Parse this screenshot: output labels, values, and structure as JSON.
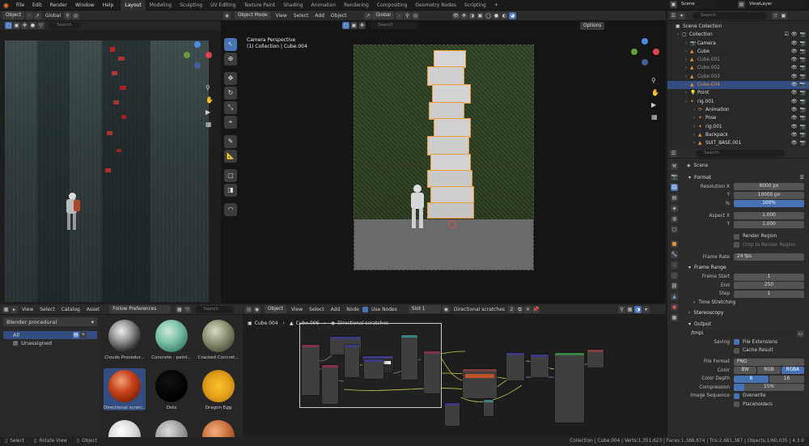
{
  "topbar": {
    "menus": [
      "File",
      "Edit",
      "Render",
      "Window",
      "Help"
    ],
    "workspaces": [
      "Layout",
      "Modeling",
      "Sculpting",
      "UV Editing",
      "Texture Paint",
      "Shading",
      "Animation",
      "Rendering",
      "Compositing",
      "Geometry Nodes",
      "Scripting"
    ],
    "active_workspace": "Layout",
    "add_tab": "+",
    "scene": "Scene",
    "view_layer": "ViewLayer"
  },
  "image_viewer": {
    "mode": "Object",
    "orientation": "Global",
    "search_placeholder": "Search"
  },
  "viewport": {
    "mode": "Object Mode",
    "menus": [
      "View",
      "Select",
      "Add",
      "Object"
    ],
    "orientation": "Global",
    "options": "Options",
    "title": "Camera Perspective",
    "subtitle": "(1) Collection | Cube.004",
    "search_placeholder": "Search"
  },
  "outliner": {
    "search_placeholder": "Search",
    "items": [
      {
        "label": "Scene Collection",
        "style": "nm"
      },
      {
        "label": "Collection",
        "style": "nm"
      },
      {
        "label": "Camera",
        "style": "nm"
      },
      {
        "label": "Cube",
        "style": "nm"
      },
      {
        "label": "Cube.001",
        "style": "dim"
      },
      {
        "label": "Cube.002",
        "style": "dim"
      },
      {
        "label": "Cube.003",
        "style": "dim"
      },
      {
        "label": "Cube.004",
        "style": "or"
      },
      {
        "label": "Point",
        "style": "nm"
      },
      {
        "label": "rig.001",
        "style": "nm"
      },
      {
        "label": "Animation",
        "style": "nm"
      },
      {
        "label": "Pose",
        "style": "nm"
      },
      {
        "label": "rig.001",
        "style": "nm"
      },
      {
        "label": "Backpack",
        "style": "nm"
      },
      {
        "label": "SUIT_BASE.001",
        "style": "nm"
      }
    ]
  },
  "properties": {
    "search_placeholder": "Search",
    "scene_label": "Scene",
    "format": {
      "title": "Format",
      "resolution_x_label": "Resolution X",
      "resolution_x": "8000 px",
      "resolution_y_label": "Y",
      "resolution_y": "10000 px",
      "percent_label": "%",
      "percent": "100%",
      "aspect_x_label": "Aspect X",
      "aspect_x": "1.000",
      "aspect_y_label": "Y",
      "aspect_y": "1.000",
      "render_region": "Render Region",
      "crop": "Crop to Render Region",
      "frame_rate_label": "Frame Rate",
      "frame_rate": "24 fps"
    },
    "frame_range": {
      "title": "Frame Range",
      "start_label": "Frame Start",
      "start": "1",
      "end_label": "End",
      "end": "250",
      "step_label": "Step",
      "step": "1"
    },
    "time_stretching": "Time Stretching",
    "stereoscopy": "Stereoscopy",
    "output": {
      "title": "Output",
      "path": "/tmp\\",
      "saving_label": "Saving",
      "file_extensions": "File Extensions",
      "cache_result": "Cache Result",
      "file_format_label": "File Format",
      "file_format": "PNG",
      "color_label": "Color",
      "color_options": [
        "BW",
        "RGB",
        "RGBA"
      ],
      "depth_label": "Color Depth",
      "depth_options": [
        "8",
        "16"
      ],
      "compression_label": "Compression",
      "compression": "15%",
      "image_sequence_label": "Image Sequence",
      "overwrite": "Overwrite",
      "placeholders": "Placeholders"
    }
  },
  "asset_browser": {
    "menus": [
      "View",
      "Select",
      "Catalog",
      "Asset"
    ],
    "import_method": "Follow Preferences",
    "library": "Blender procedural",
    "search_placeholder": "Search",
    "catalogs": [
      "All",
      "Unassigned"
    ],
    "assets": [
      {
        "label": "Clouds Procedur...",
        "color": "radial-gradient(circle at 40% 35%,#eee 0%,#999 35%,#333 70%,#111 100%)"
      },
      {
        "label": "Concrete - paint...",
        "color": "radial-gradient(circle at 40% 35%,#cfe9dc 0%,#7cc3a7 40%,#3a7d66 80%,#1e3d33 100%)"
      },
      {
        "label": "Cracked Concret...",
        "color": "radial-gradient(circle at 40% 35%,#d6dbbe 0%,#8f9676 40%,#4b4f39 80%,#222 100%)"
      },
      {
        "label": "Directional scratc...",
        "color": "radial-gradient(circle at 40% 35%,#f0a079 0%,#c9431a 40%,#7a1f08 80%,#2a0a02 100%)"
      },
      {
        "label": "Dots",
        "color": "radial-gradient(circle at 40% 35%,#111 0%,#000 70%,#555 100%)"
      },
      {
        "label": "Dragon Egg",
        "color": "radial-gradient(circle,#f7c22c 0%,#e6a11a 50%,#9b6a0a 100%)"
      },
      {
        "label": "",
        "color": "radial-gradient(circle at 40% 35%,#fff 0%,#d5d5d5 50%,#888 100%)"
      },
      {
        "label": "",
        "color": "radial-gradient(circle at 40% 35%,#ddd 0%,#9a9a9a 50%,#444 100%)"
      },
      {
        "label": "",
        "color": "radial-gradient(circle at 40% 35%,#f3b080 0%,#c26a34 50%,#5d2c10 100%)"
      }
    ]
  },
  "node_editor": {
    "mode": "Object",
    "menus": [
      "View",
      "Select",
      "Add",
      "Node"
    ],
    "use_nodes": "Use Nodes",
    "slot": "Slot 1",
    "material": "Directional scratches",
    "users": "2",
    "breadcrumb": [
      "Cube.004",
      "Cube.006",
      "Directional scratches"
    ]
  },
  "status": {
    "select": "Select",
    "rotate": "Rotate View",
    "object": "Object",
    "stats": "Collection | Cube.004 | Verts:1,351,623 | Faces:1,388,674 | Tris:2,681,387 | Objects:1/60,035 | 4.3.0"
  }
}
